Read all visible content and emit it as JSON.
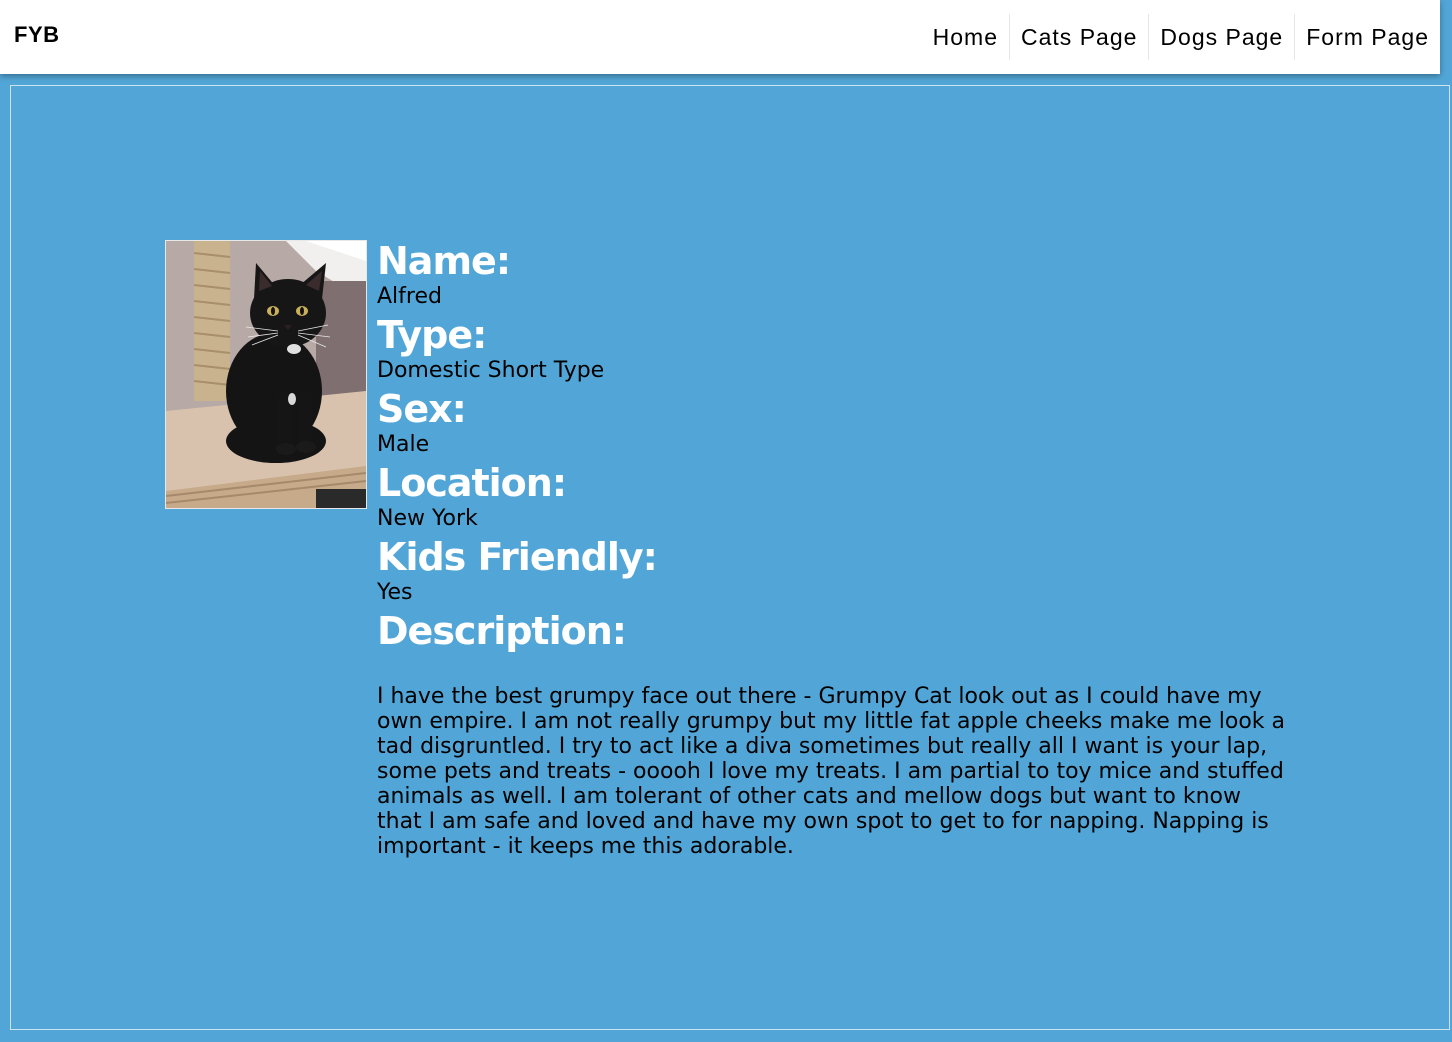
{
  "navbar": {
    "brand": "FYB",
    "links": [
      {
        "label": "Home"
      },
      {
        "label": "Cats Page"
      },
      {
        "label": "Dogs Page"
      },
      {
        "label": "Form Page"
      }
    ]
  },
  "pet": {
    "photo_icon": "cat-photo",
    "fields": {
      "name": {
        "label": "Name:",
        "value": "Alfred"
      },
      "type": {
        "label": "Type:",
        "value": "Domestic Short Type"
      },
      "sex": {
        "label": "Sex:",
        "value": "Male"
      },
      "location": {
        "label": "Location:",
        "value": "New York"
      },
      "kids": {
        "label": "Kids Friendly:",
        "value": "Yes"
      },
      "description": {
        "label": "Description:",
        "value": "I have the best grumpy face out there - Grumpy Cat look out as I could have my own empire. I am not really grumpy but my little fat apple cheeks make me look a tad disgruntled. I try to act like a diva sometimes but really all I want is your lap, some pets and treats - ooooh I love my treats. I am partial to toy mice and stuffed animals as well. I am tolerant of other cats and mellow dogs but want to know that I am safe and loved and have my own spot to get to for napping. Napping is important - it keeps me this adorable."
      }
    }
  },
  "colors": {
    "page_background": "#52a6d7",
    "navbar_background": "#ffffff",
    "label_color": "#ffffff",
    "text_color": "#000000"
  }
}
